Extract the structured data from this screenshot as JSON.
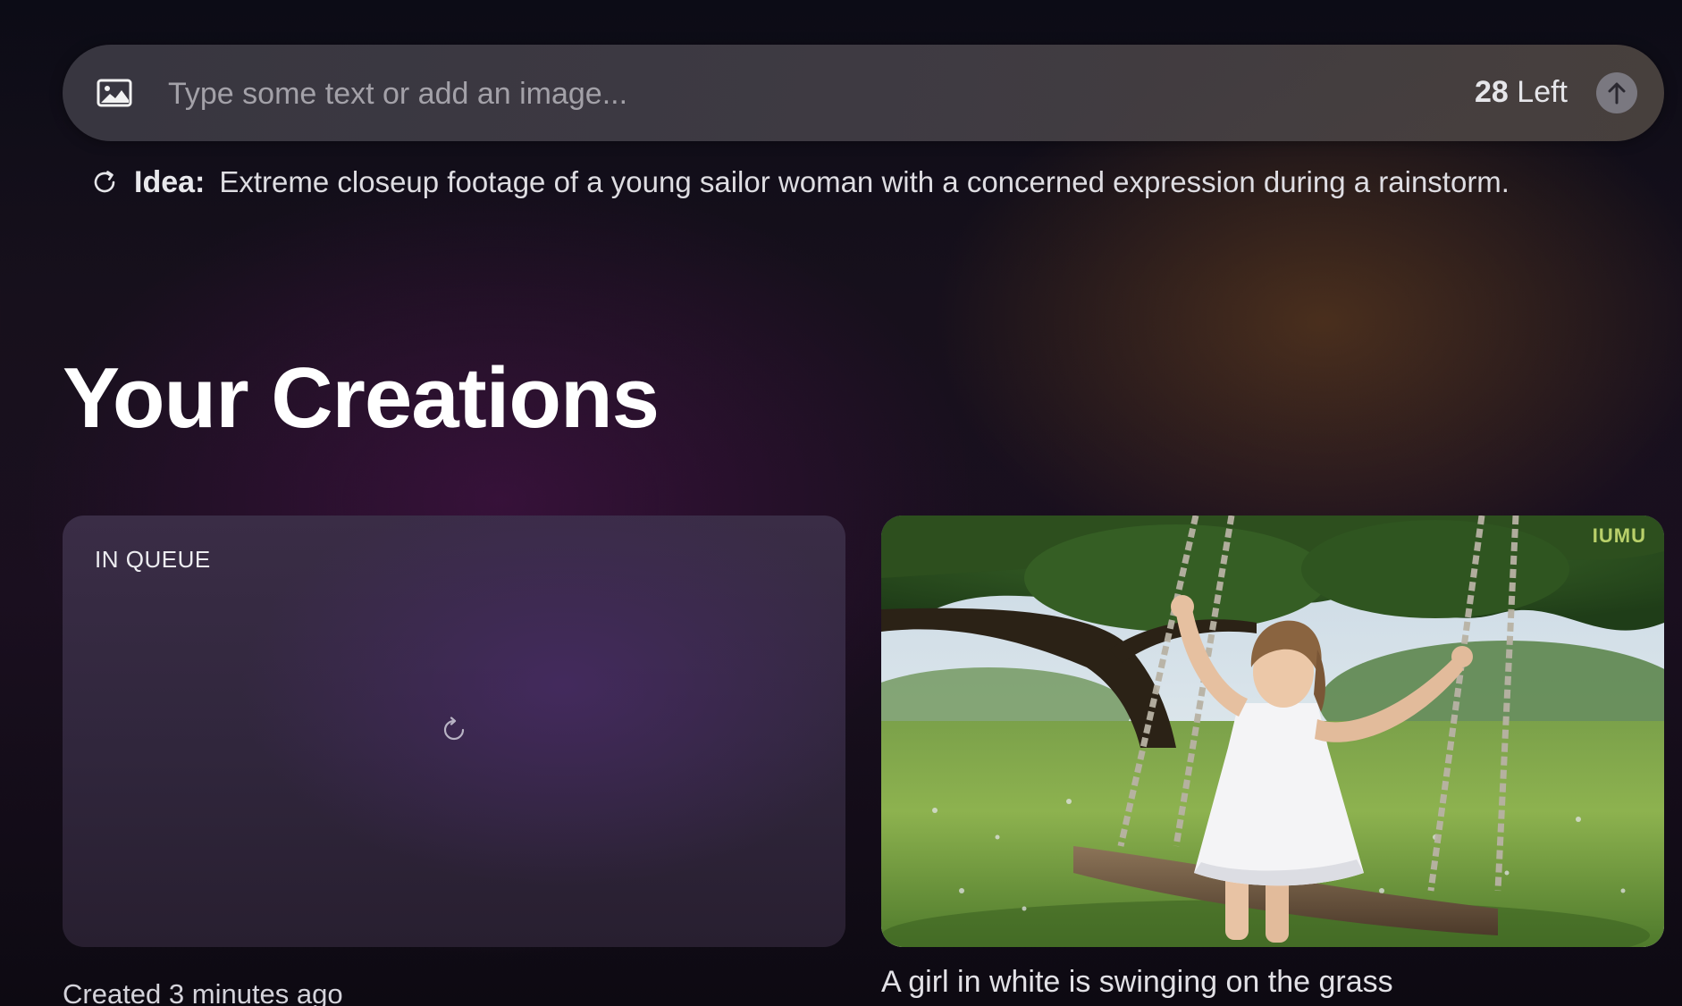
{
  "prompt_bar": {
    "placeholder": "Type some text or add an image...",
    "credits_number": "28",
    "credits_suffix": "Left",
    "image_icon": "image-icon",
    "submit_icon": "arrow-up-icon"
  },
  "idea": {
    "label": "Idea:",
    "text": "Extreme closeup footage of a young sailor woman with a concerned expression during a rainstorm.",
    "icon": "refresh-icon"
  },
  "section_title": "Your Creations",
  "creations": [
    {
      "status": "IN QUEUE",
      "caption": "Created 3 minutes ago",
      "icon": "loading-icon"
    },
    {
      "caption": "A girl in white is swinging on the grass",
      "watermark": "IUMU"
    }
  ],
  "colors": {
    "submit_button": "#7a7880",
    "queue_card": "#30263c",
    "accent_glow_warm": "#73481e",
    "accent_glow_purple": "#401242"
  }
}
